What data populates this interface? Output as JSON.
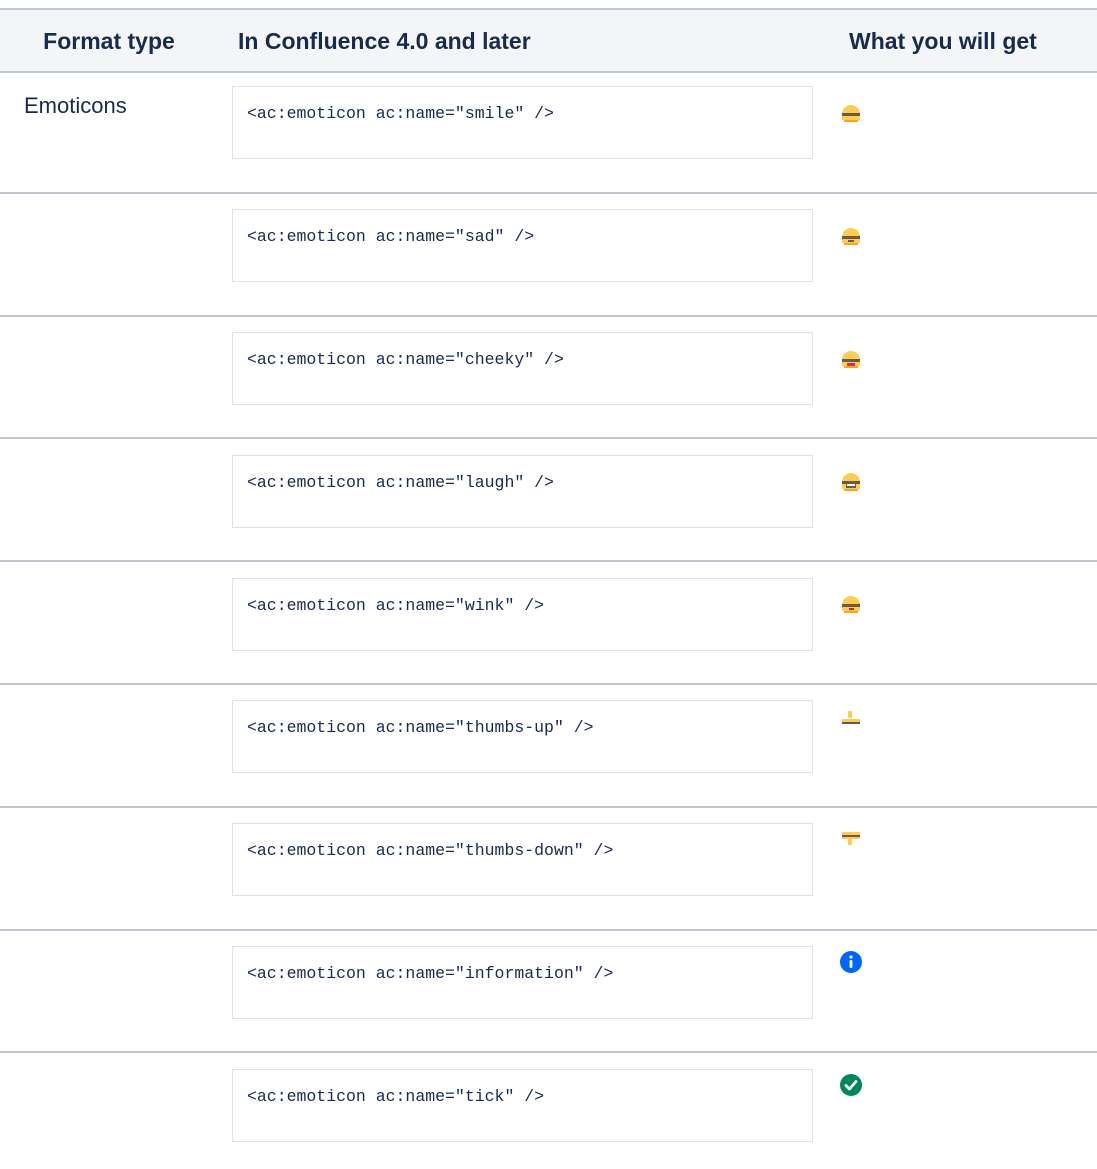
{
  "table": {
    "headers": [
      "Format type",
      "In Confluence 4.0 and later",
      "What you will get"
    ],
    "rows": [
      {
        "format_type": "Emoticons",
        "code": "<ac:emoticon ac:name=\"smile\" />",
        "icon": "smile-icon"
      },
      {
        "format_type": "",
        "code": "<ac:emoticon ac:name=\"sad\" />",
        "icon": "sad-icon"
      },
      {
        "format_type": "",
        "code": "<ac:emoticon ac:name=\"cheeky\" />",
        "icon": "cheeky-icon"
      },
      {
        "format_type": "",
        "code": "<ac:emoticon ac:name=\"laugh\" />",
        "icon": "laugh-icon"
      },
      {
        "format_type": "",
        "code": "<ac:emoticon ac:name=\"wink\" />",
        "icon": "wink-icon"
      },
      {
        "format_type": "",
        "code": "<ac:emoticon ac:name=\"thumbs-up\" />",
        "icon": "thumbs-up-icon"
      },
      {
        "format_type": "",
        "code": "<ac:emoticon ac:name=\"thumbs-down\" />",
        "icon": "thumbs-down-icon"
      },
      {
        "format_type": "",
        "code": "<ac:emoticon ac:name=\"information\" />",
        "icon": "information-icon"
      },
      {
        "format_type": "",
        "code": "<ac:emoticon ac:name=\"tick\" />",
        "icon": "tick-icon"
      }
    ]
  },
  "colors": {
    "header_bg": "#f4f5f7",
    "border": "#c1c7d0",
    "emoji_yellow": "#ffcc4d",
    "info_blue": "#0065ff",
    "tick_green": "#00875a"
  }
}
